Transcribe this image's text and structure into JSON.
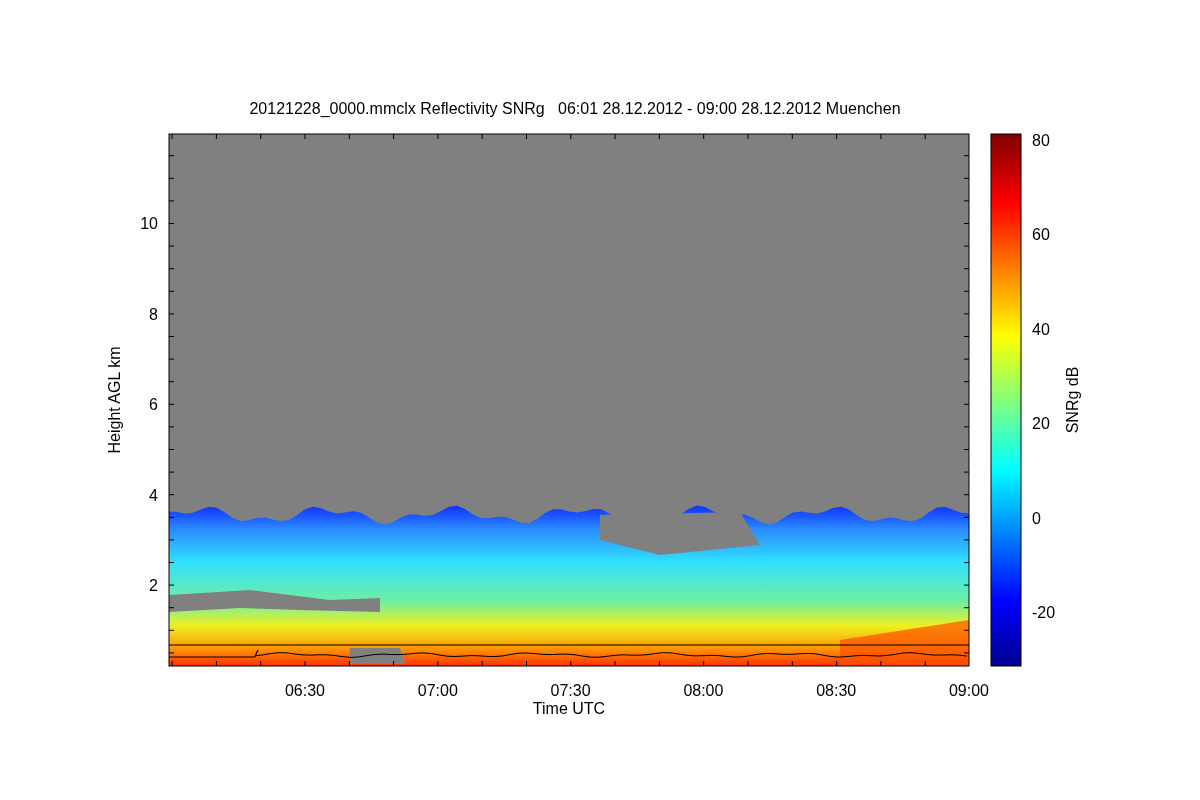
{
  "title": "20121228_0000.mmclx Reflectivity SNRg   06:01 28.12.2012 - 09:00 28.12.2012 Muenchen",
  "y_axis": {
    "label": "Height AGL km",
    "ticks": [
      "10",
      "8",
      "6",
      "4",
      "2"
    ]
  },
  "x_axis": {
    "label": "Time UTC",
    "ticks": [
      "06:30",
      "07:00",
      "07:30",
      "08:00",
      "08:30",
      "09:00"
    ]
  },
  "colorbar": {
    "label": "SNRg dB",
    "ticks": [
      "80",
      "60",
      "40",
      "20",
      "0",
      "-20"
    ]
  }
}
